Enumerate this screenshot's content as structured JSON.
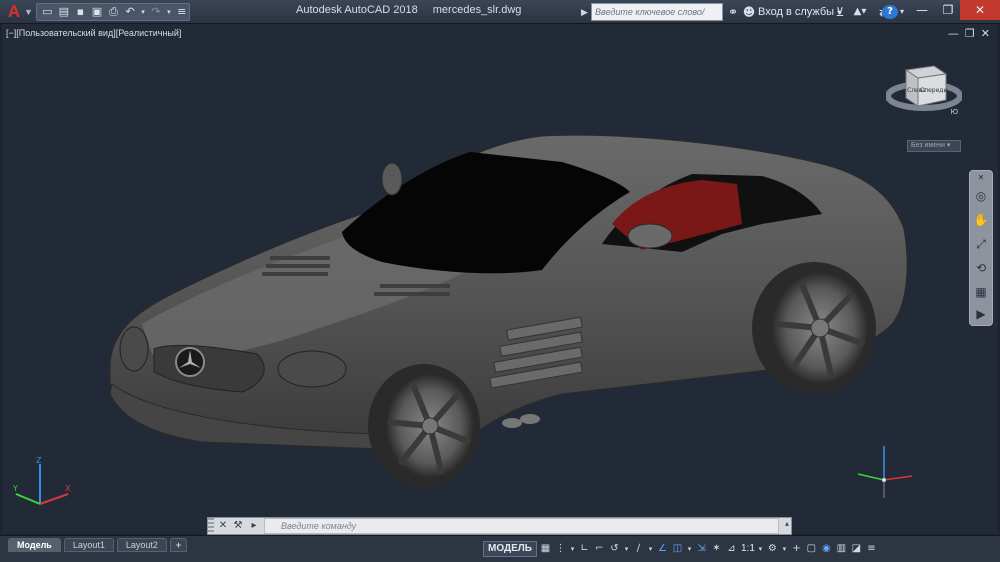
{
  "titlebar": {
    "app_name": "Autodesk AutoCAD 2018",
    "file_name": "mercedes_slr.dwg",
    "search_placeholder": "Введите ключевое слово/фразу",
    "signin_label": "Вход в службы",
    "help_label": "?"
  },
  "qat": {
    "icons": [
      "new-icon",
      "open-icon",
      "save-icon",
      "saveas-icon",
      "plot-icon",
      "undo-icon",
      "redo-icon"
    ]
  },
  "viewport": {
    "label": "[−][Пользовательский вид][Реалистичный]",
    "controls": [
      "—",
      "❐",
      "✕"
    ]
  },
  "viewcube": {
    "left_face": "Слева",
    "front_face": "Спереди",
    "compass_letter": "Ю",
    "ucs_label": "Без имени"
  },
  "ucs": {
    "x_label": "X",
    "y_label": "Y",
    "z_label": "Z"
  },
  "command_line": {
    "placeholder": "Введите команду"
  },
  "layout_tabs": [
    {
      "label": "Модель",
      "active": true
    },
    {
      "label": "Layout1",
      "active": false
    },
    {
      "label": "Layout2",
      "active": false
    },
    {
      "label": "+",
      "active": false
    }
  ],
  "status": {
    "model_label": "МОДЕЛЬ",
    "scale_label": "1:1"
  },
  "colors": {
    "background": "#222a37",
    "car_body": "#555555",
    "interior": "#7a1818",
    "accent": "#e0302a"
  }
}
